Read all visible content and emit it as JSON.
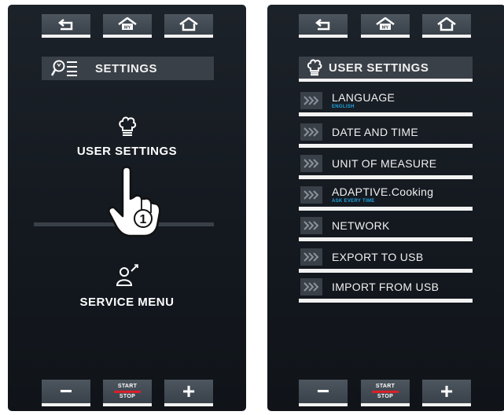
{
  "colors": {
    "panel_bg": "#161b21",
    "button_bg": "#434b54",
    "underline": "#f2f2f2",
    "accent_blue": "#1fa3e0",
    "stop_red": "#d8202a"
  },
  "left_panel": {
    "topbar": [
      "back-icon",
      "myhome-icon",
      "home-icon"
    ],
    "header": {
      "icon": "search-list-icon",
      "title": "SETTINGS"
    },
    "options": [
      {
        "icon": "chef-hat-icon",
        "label": "USER SETTINGS"
      },
      {
        "icon": "technician-icon",
        "label": "SERVICE MENU"
      }
    ],
    "pointer": {
      "icon": "hand-pointer-icon",
      "step": "1"
    }
  },
  "right_panel": {
    "topbar": [
      "back-icon",
      "myhome-icon",
      "home-icon"
    ],
    "header": {
      "icon": "chef-hat-icon",
      "title": "USER SETTINGS"
    },
    "items": [
      {
        "label": "LANGUAGE",
        "sub": "ENGLISH"
      },
      {
        "label": "DATE AND TIME",
        "sub": ""
      },
      {
        "label": "UNIT OF MEASURE",
        "sub": ""
      },
      {
        "label": "ADAPTIVE.Cooking",
        "sub": "ASK EVERY TIME"
      },
      {
        "label": "NETWORK",
        "sub": ""
      },
      {
        "label": "EXPORT TO USB",
        "sub": ""
      },
      {
        "label": "IMPORT FROM USB",
        "sub": ""
      }
    ]
  },
  "bottom_bar": {
    "minus": "−",
    "start": "START",
    "stop": "STOP",
    "plus": "+"
  }
}
